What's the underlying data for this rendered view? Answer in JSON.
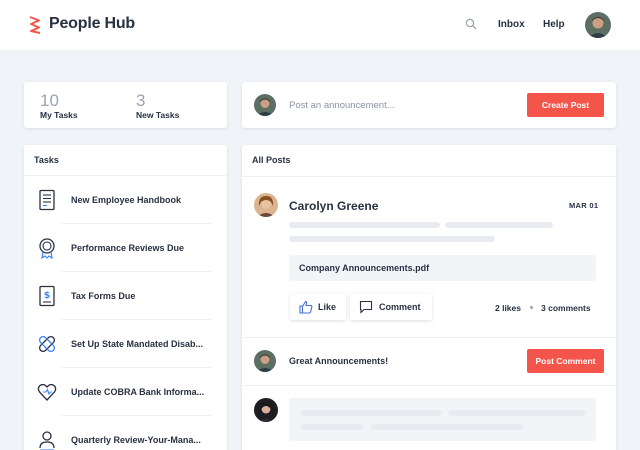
{
  "header": {
    "brand": "People Hub",
    "brand_color": "#f4554a",
    "nav": {
      "inbox": "Inbox",
      "help": "Help"
    }
  },
  "stats": [
    {
      "value": "10",
      "label": "My Tasks"
    },
    {
      "value": "3",
      "label": "New Tasks"
    }
  ],
  "announcement": {
    "placeholder": "Post an announcement...",
    "button": "Create Post"
  },
  "tasks": {
    "title": "Tasks",
    "items": [
      {
        "label": "New Employee Handbook",
        "icon": "document-icon"
      },
      {
        "label": "Performance Reviews Due",
        "icon": "badge-icon"
      },
      {
        "label": "Tax Forms Due",
        "icon": "dollar-document-icon"
      },
      {
        "label": "Set Up State Mandated Disab...",
        "icon": "bandage-icon"
      },
      {
        "label": "Update COBRA Bank Informa...",
        "icon": "heart-icon"
      },
      {
        "label": "Quarterly Review-Your-Mana...",
        "icon": "person-icon"
      }
    ]
  },
  "posts": {
    "title": "All Posts",
    "post": {
      "author": "Carolyn Greene",
      "date": "MAR 01",
      "attachment": "Company Announcements.pdf",
      "like_label": "Like",
      "comment_label": "Comment",
      "likes": "2 likes",
      "comments": "3 comments"
    },
    "comment": {
      "text": "Great Announcements!",
      "button": "Post Comment"
    }
  },
  "colors": {
    "accent": "#f4554a",
    "text": "#283142",
    "background": "#f0f4f8",
    "skeleton": "#e8ecf1"
  }
}
